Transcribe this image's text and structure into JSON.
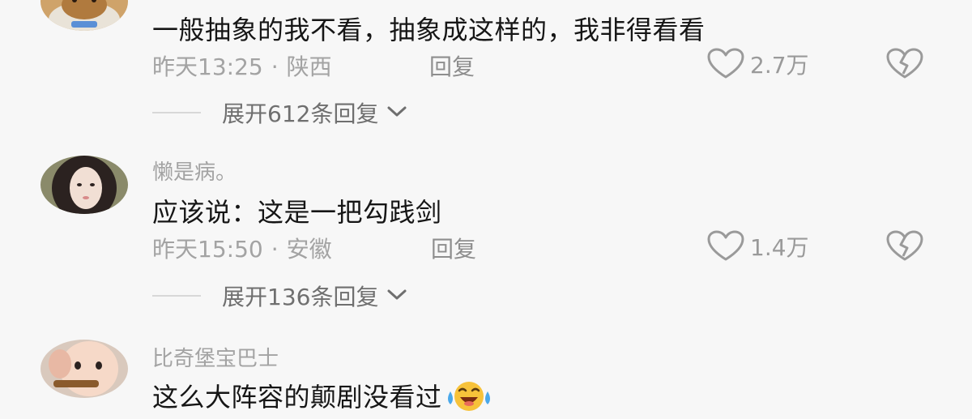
{
  "comments": [
    {
      "text": "一般抽象的我不看，抽象成这样的，我非得看看",
      "time": "昨天13:25",
      "location": "陕西",
      "reply_label": "回复",
      "likes": "2.7万",
      "expand_label": "展开612条回复"
    },
    {
      "username": "懒是病。",
      "text": "应该说：这是一把勾践剑",
      "time": "昨天15:50",
      "location": "安徽",
      "reply_label": "回复",
      "likes": "1.4万",
      "expand_label": "展开136条回复"
    },
    {
      "username": "比奇堡宝巴士",
      "text": "这么大阵容的颠剧没看过",
      "emoji": "crying-laughing-emoji"
    }
  ],
  "separator": "·",
  "icons": [
    "heart-icon",
    "broken-heart-icon",
    "chevron-down-icon"
  ],
  "colors": {
    "primary_text": "#161616",
    "secondary_text": "#a3a3a3",
    "background": "#f7f7f7"
  }
}
